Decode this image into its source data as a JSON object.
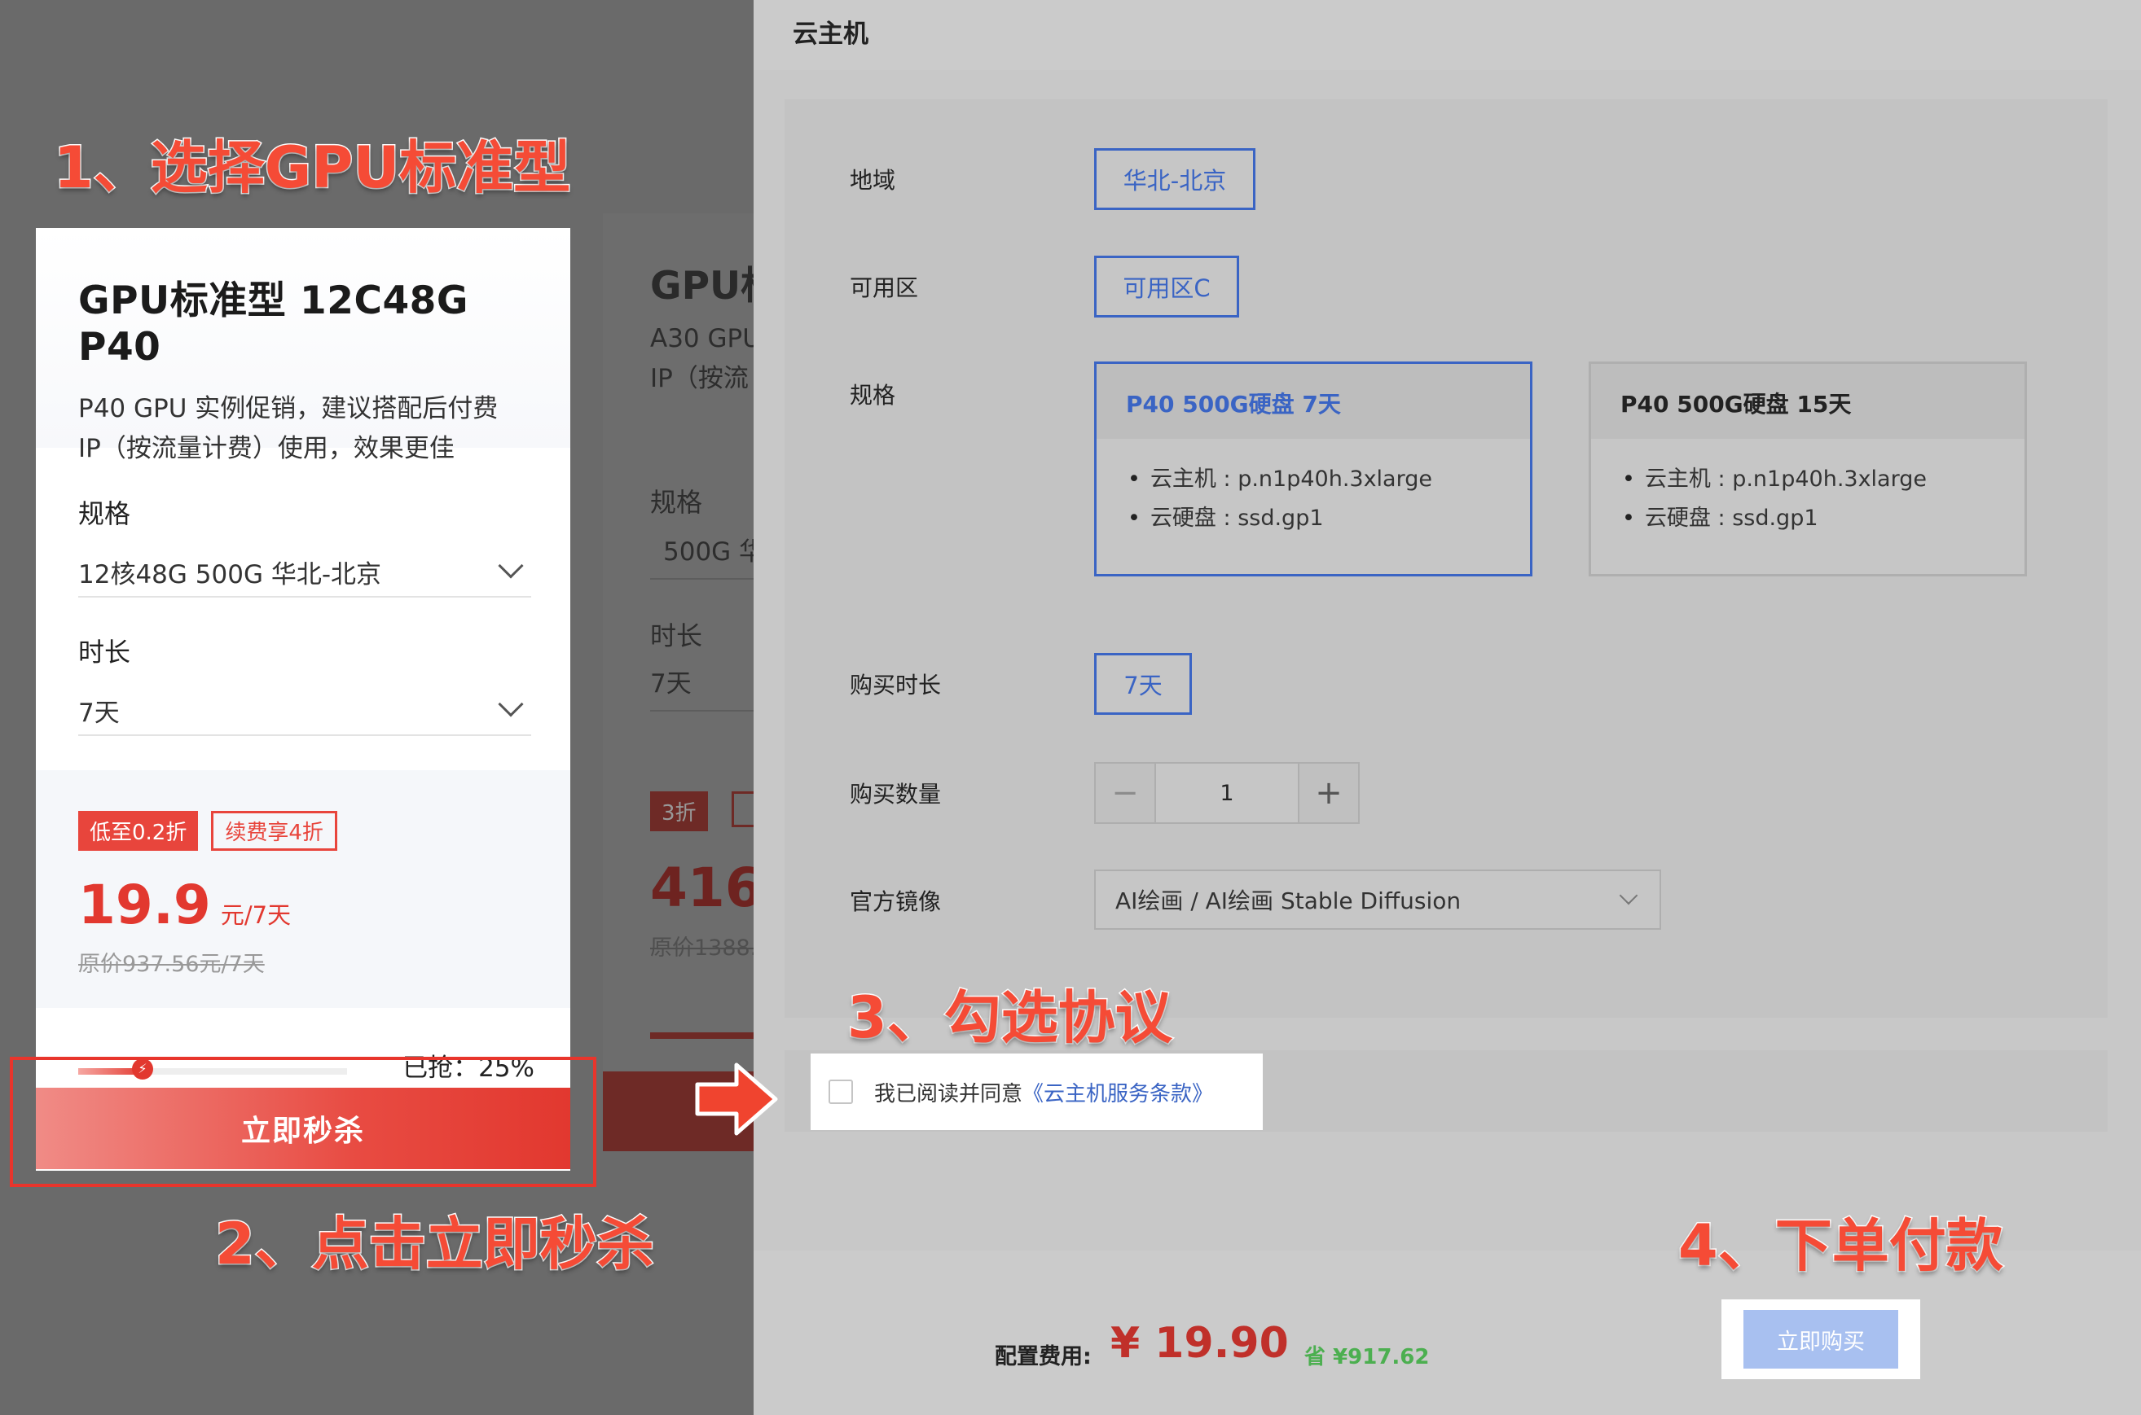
{
  "promo": {
    "card": {
      "title": "GPU标准型 12C48G P40",
      "description_lines": [
        "P40 GPU 实例促销，建议搭配后付费",
        "IP（按流量计费）使用，效果更佳"
      ],
      "spec_label": "规格",
      "spec_value": "12核48G  500G 华北-北京",
      "duration_label": "时长",
      "duration_value": "7天",
      "tags": [
        "低至0.2折",
        "续费享4折"
      ],
      "price": "19.9",
      "price_unit": "元/7天",
      "original_price": "原价937.56元/7天",
      "progress_text": "已抢：25%",
      "progress_fraction": 0.25,
      "button": "立即秒杀"
    },
    "card2": {
      "title": "GPU标",
      "desc_lines": [
        "A30 GPU",
        "IP（按流"
      ],
      "spec_label": "规格",
      "spec_value": "500G 华",
      "duration_label": "时长",
      "duration_value": "7天",
      "tag": "3折",
      "price": "416",
      "original_price": "原价1388."
    }
  },
  "annotations": {
    "step1": "1、选择GPU标准型",
    "step2": "2、点击立即秒杀",
    "step3": "3、勾选协议",
    "step4": "4、下单付款"
  },
  "drawer": {
    "title": "云主机",
    "region_label": "地域",
    "region_value": "华北-北京",
    "zone_label": "可用区",
    "zone_value": "可用区C",
    "spec_label": "规格",
    "specs": [
      {
        "name": "P40 500G硬盘 7天",
        "lines": [
          "云主机 : p.n1p40h.3xlarge",
          "云硬盘 : ssd.gp1"
        ],
        "selected": true
      },
      {
        "name": "P40 500G硬盘 15天",
        "lines": [
          "云主机 : p.n1p40h.3xlarge",
          "云硬盘 : ssd.gp1"
        ],
        "selected": false
      }
    ],
    "duration_label": "购买时长",
    "duration_value": "7天",
    "quantity_label": "购买数量",
    "quantity_value": "1",
    "image_label": "官方镜像",
    "image_value": "AI绘画 / AI绘画 Stable Diffusion",
    "agreement_text": "我已阅读并同意",
    "agreement_link": "《云主机服务条款》",
    "fee_label": "配置费用:",
    "fee_amount": "¥ 19.90",
    "fee_save": "省 ¥917.62",
    "buy_button": "立即购买"
  },
  "colors": {
    "accent_blue": "#3a64c4",
    "promo_red": "#e2382f",
    "save_green": "#4caf50"
  }
}
